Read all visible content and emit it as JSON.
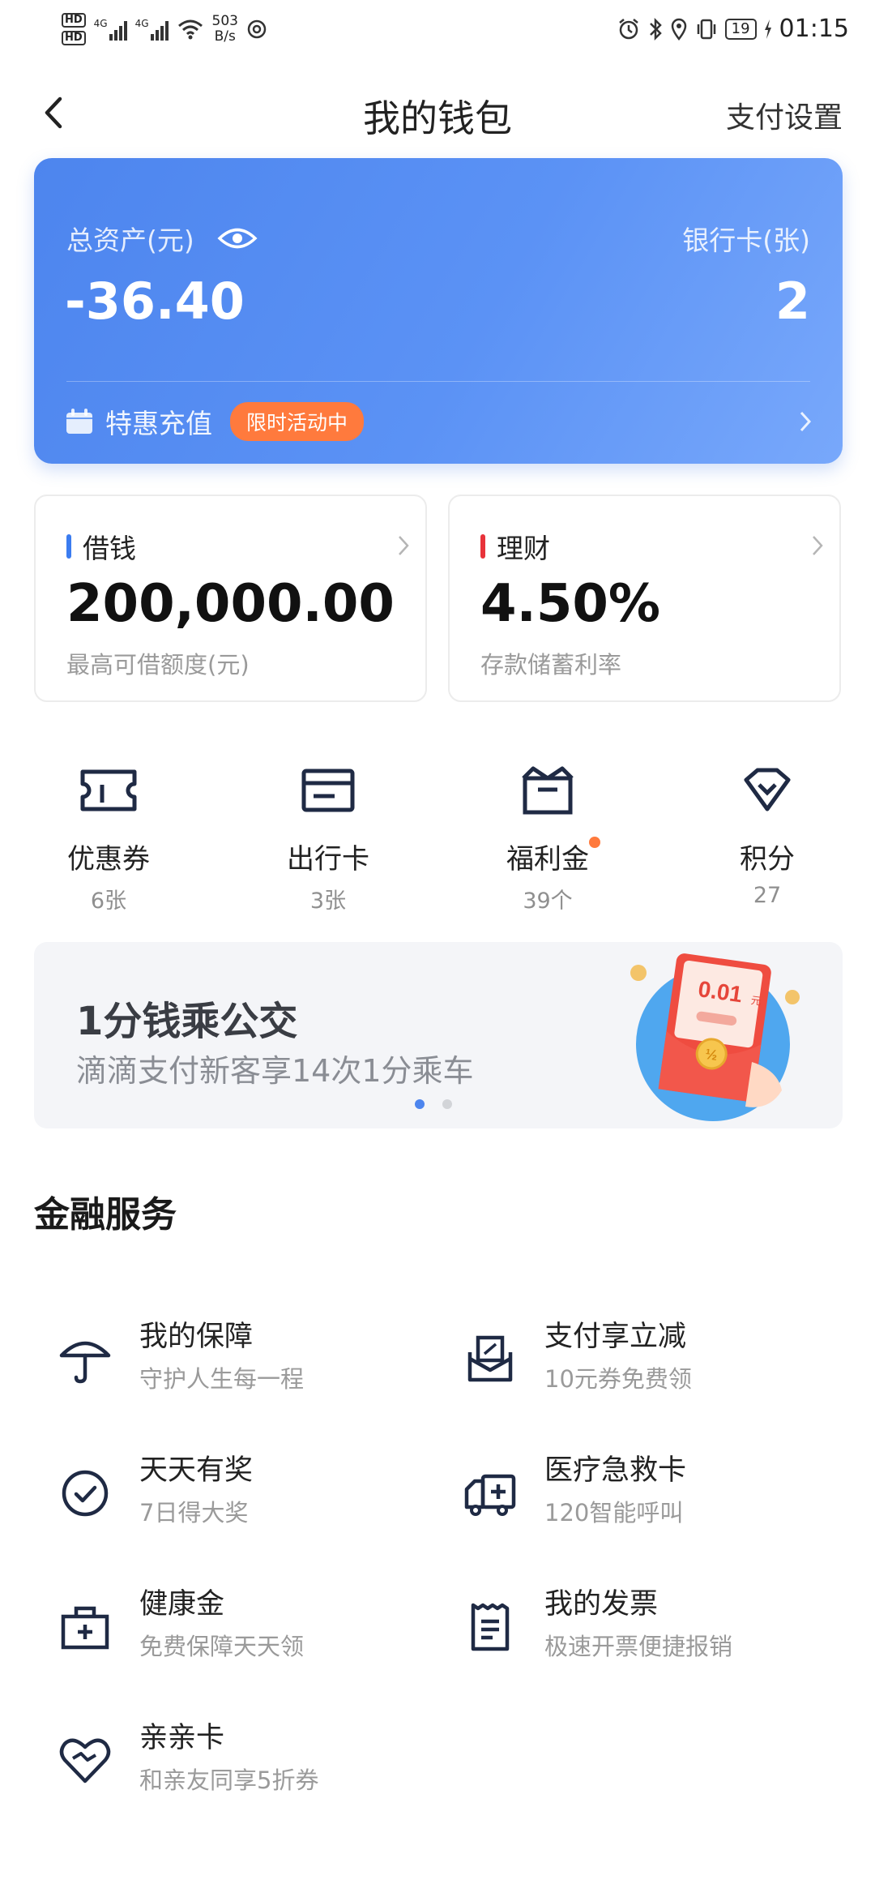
{
  "status_bar": {
    "net_speed_value": "503",
    "net_speed_unit": "B/s",
    "signal_label_1": "4G",
    "signal_label_2": "4G",
    "battery": "19",
    "time": "01:15"
  },
  "header": {
    "title": "我的钱包",
    "right_action": "支付设置"
  },
  "asset_card": {
    "total_label": "总资产(元)",
    "total_value": "-36.40",
    "bank_label": "银行卡(张)",
    "bank_count": "2",
    "promo_text": "特惠充值",
    "promo_badge": "限时活动中"
  },
  "tiles": [
    {
      "title": "借钱",
      "value": "200,000.00",
      "sub": "最高可借额度(元)",
      "bar_color": "#3b7cf0"
    },
    {
      "title": "理财",
      "value": "4.50%",
      "sub": "存款储蓄利率",
      "bar_color": "#e8333a"
    }
  ],
  "quick_items": [
    {
      "name": "优惠券",
      "count": "6张",
      "icon": "ticket-icon"
    },
    {
      "name": "出行卡",
      "count": "3张",
      "icon": "card-icon"
    },
    {
      "name": "福利金",
      "count": "39个",
      "icon": "gift-box-icon",
      "has_dot": true
    },
    {
      "name": "积分",
      "count": "27",
      "icon": "diamond-icon"
    }
  ],
  "banner": {
    "title": "1分钱乘公交",
    "subtitle": "滴滴支付新客享14次1分乘车",
    "envelope_amount": "0.01",
    "envelope_unit": "元",
    "coin_label": "½",
    "dots": 2,
    "active_dot": 0
  },
  "financial_services": {
    "title": "金融服务",
    "items": [
      {
        "title": "我的保障",
        "sub": "守护人生每一程",
        "icon": "umbrella-icon"
      },
      {
        "title": "支付享立减",
        "sub": "10元券免费领",
        "icon": "envelope-discount-icon"
      },
      {
        "title": "天天有奖",
        "sub": "7日得大奖",
        "icon": "check-circle-icon"
      },
      {
        "title": "医疗急救卡",
        "sub": "120智能呼叫",
        "icon": "ambulance-icon"
      },
      {
        "title": "健康金",
        "sub": "免费保障天天领",
        "icon": "medical-kit-icon"
      },
      {
        "title": "我的发票",
        "sub": "极速开票便捷报销",
        "icon": "invoice-icon"
      },
      {
        "title": "亲亲卡",
        "sub": "和亲友同享5折券",
        "icon": "heart-icon"
      }
    ]
  },
  "colors": {
    "card_gradient_start": "#4d85ee",
    "card_gradient_end": "#78a8fb",
    "promo_badge": "#ff7a3d",
    "dot_active": "#4d85ee",
    "icon_stroke": "#1f2a44"
  }
}
